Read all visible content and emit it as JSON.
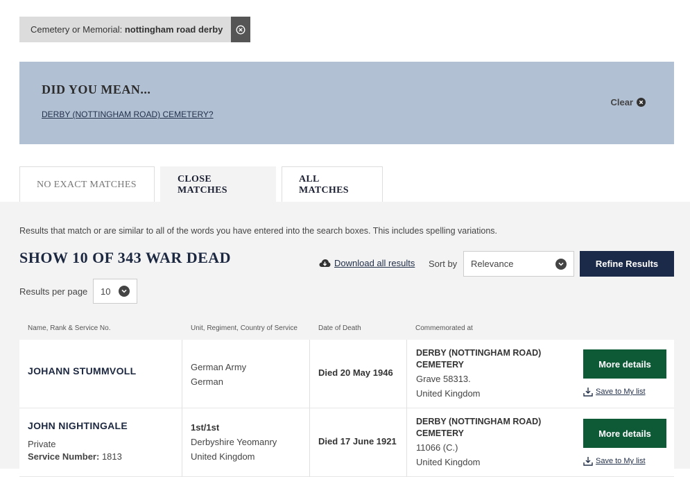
{
  "filter": {
    "label": "Cemetery or Memorial:",
    "value": "nottingham road derby"
  },
  "did_you_mean": {
    "title": "DID YOU MEAN...",
    "suggestion": "DERBY (NOTTINGHAM ROAD) CEMETERY?",
    "clear_label": "Clear"
  },
  "tabs": [
    {
      "label": "NO EXACT MATCHES"
    },
    {
      "label": "CLOSE MATCHES"
    },
    {
      "label": "ALL MATCHES"
    }
  ],
  "results": {
    "description": "Results that match or are similar to all of the words you have entered into the search boxes. This includes spelling variations.",
    "heading": "SHOW 10 OF 343 WAR DEAD",
    "download_label": "Download all results",
    "sort_label": "Sort by",
    "sort_value": "Relevance",
    "refine_label": "Refine Results",
    "per_page_label": "Results per page",
    "per_page_value": "10"
  },
  "columns": {
    "name": "Name, Rank & Service No.",
    "unit": "Unit, Regiment, Country of Service",
    "date": "Date of Death",
    "commemorated": "Commemorated at"
  },
  "rows": [
    {
      "name": "JOHANN STUMMVOLL",
      "unit_line1": "German Army",
      "unit_line2": "German",
      "date": "Died 20 May 1946",
      "cemetery_line1": "DERBY (NOTTINGHAM ROAD)",
      "cemetery_line2": "CEMETERY",
      "grave": "Grave 58313.",
      "country": "United Kingdom",
      "more_label": "More details",
      "save_label": "Save to My list"
    },
    {
      "name": "JOHN NIGHTINGALE",
      "rank": "Private",
      "service_label": "Service Number:",
      "service_no": "1813",
      "unit_line1": "1st/1st",
      "unit_line2": "Derbyshire Yeomanry",
      "unit_line3": "United Kingdom",
      "date": "Died 17 June 1921",
      "cemetery_line1": "DERBY (NOTTINGHAM ROAD)",
      "cemetery_line2": "CEMETERY",
      "grave": "11066 (C.)",
      "country": "United Kingdom",
      "more_label": "More details",
      "save_label": "Save to My list"
    }
  ],
  "colors": {
    "navy": "#1c2a4a",
    "green": "#0e5a37",
    "banner": "#b2c0d4",
    "panel": "#f3f3f3"
  }
}
